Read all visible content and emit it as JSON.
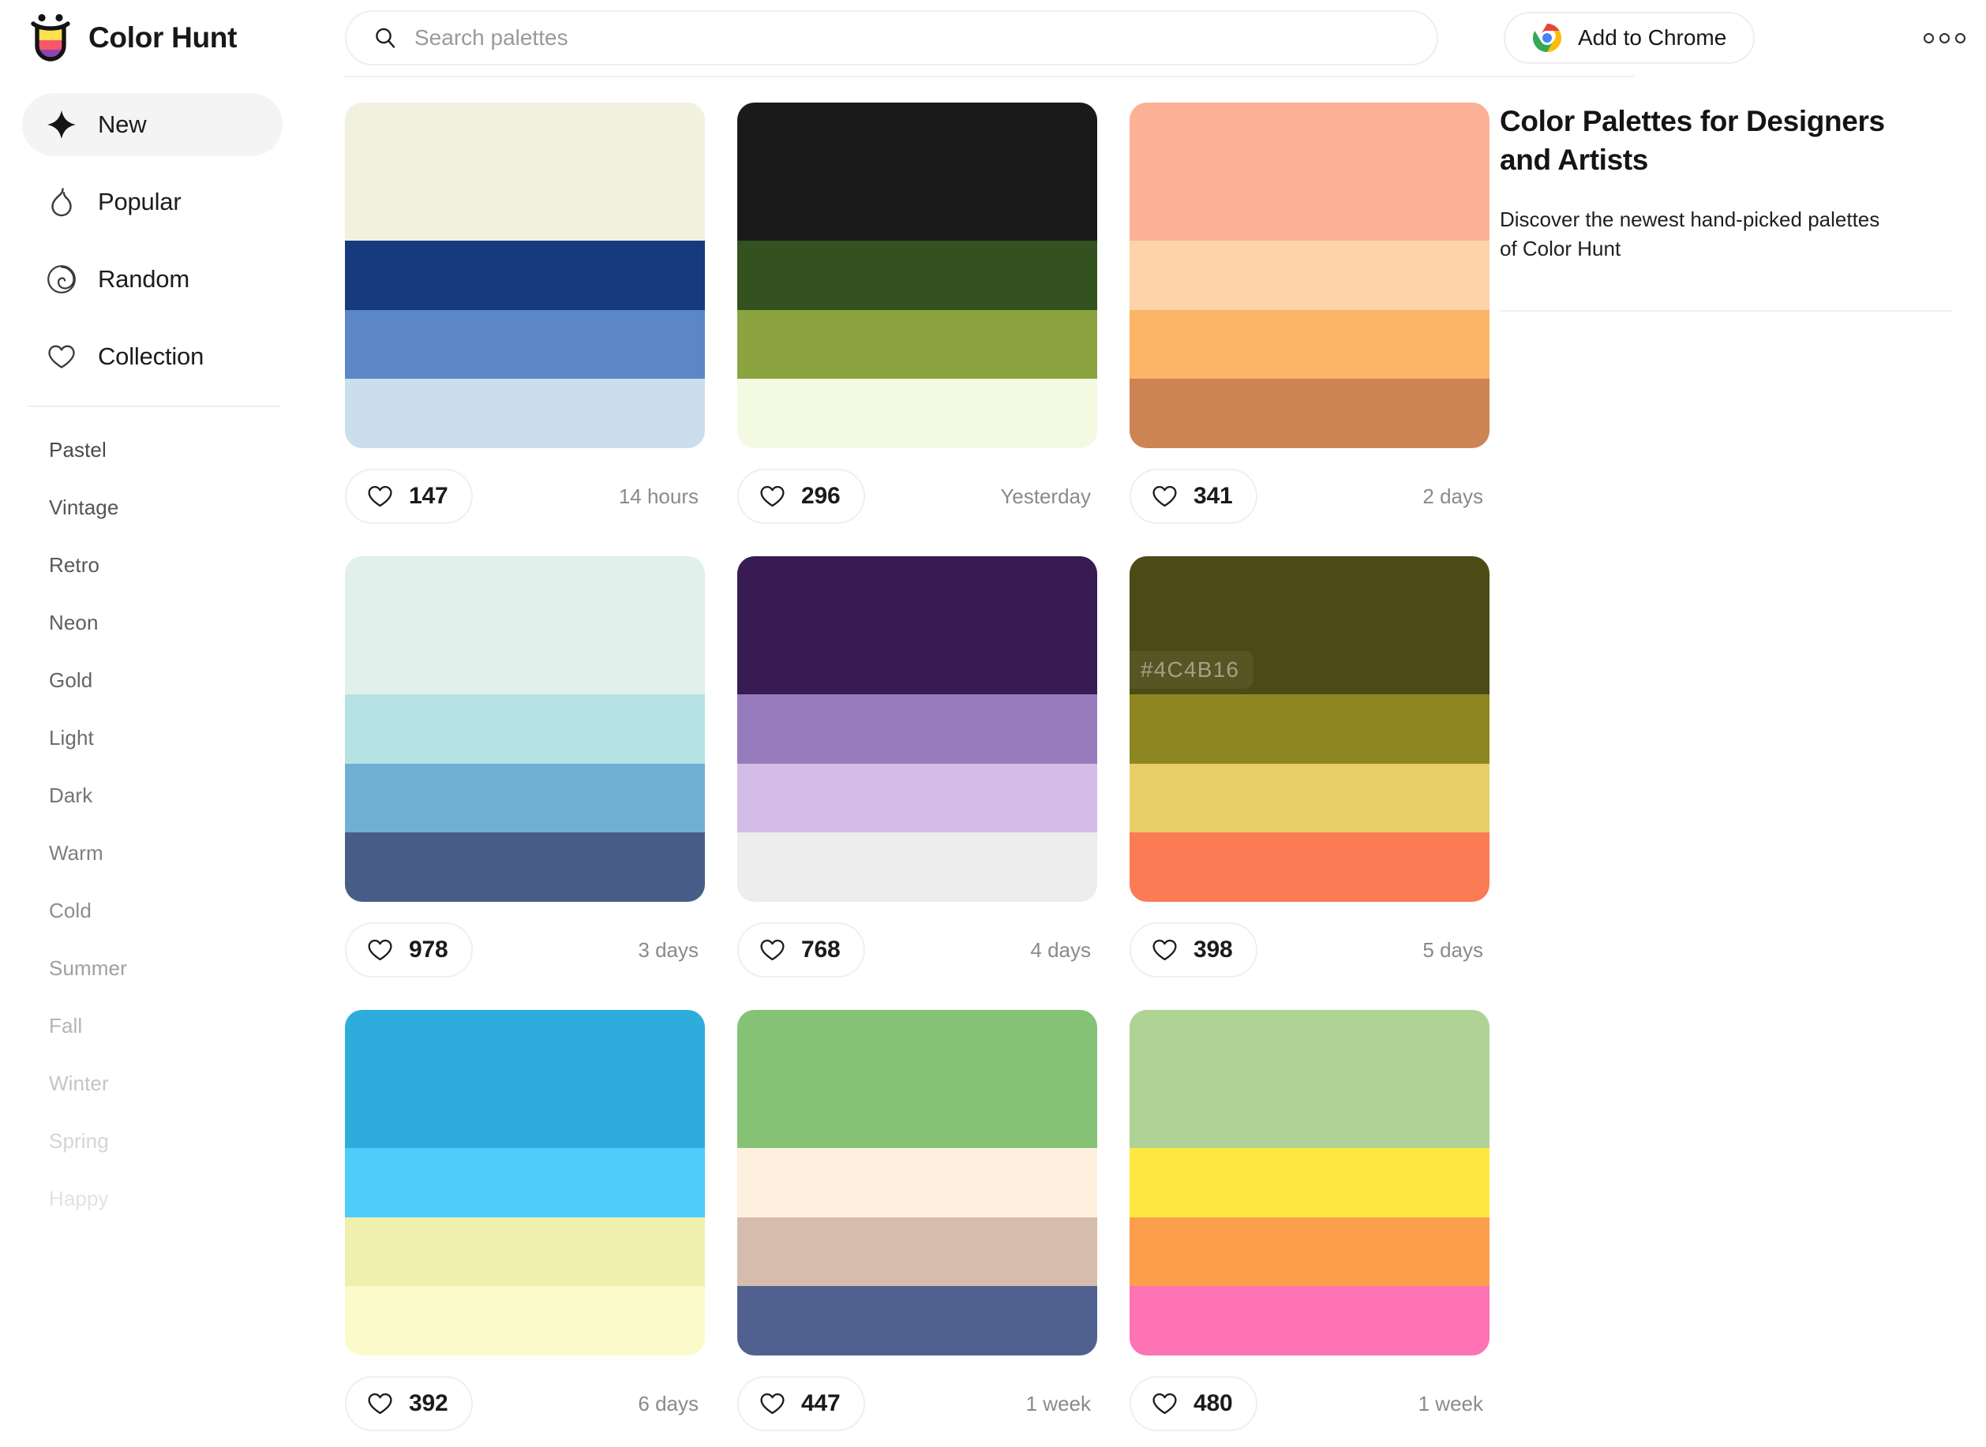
{
  "brand": {
    "name": "Color Hunt",
    "logo_icon": "color-hunt-cup-logo",
    "logo_colors": [
      "#FFE14D",
      "#F8566B",
      "#8E44AD"
    ]
  },
  "search": {
    "placeholder": "Search palettes",
    "value": "",
    "icon": "search-icon"
  },
  "header": {
    "chrome_button_label": "Add to Chrome",
    "chrome_icon": "chrome-icon",
    "more_icon": "three-dots-icon"
  },
  "sidebar": {
    "nav": [
      {
        "label": "New",
        "icon": "sparkle-icon",
        "active": true
      },
      {
        "label": "Popular",
        "icon": "flame-icon",
        "active": false
      },
      {
        "label": "Random",
        "icon": "spiral-icon",
        "active": false
      },
      {
        "label": "Collection",
        "icon": "heart-icon",
        "active": false
      }
    ],
    "tags": [
      {
        "label": "Pastel",
        "color": "#4a4a4a"
      },
      {
        "label": "Vintage",
        "color": "#545454"
      },
      {
        "label": "Retro",
        "color": "#585858"
      },
      {
        "label": "Neon",
        "color": "#5e5e5e"
      },
      {
        "label": "Gold",
        "color": "#646464"
      },
      {
        "label": "Light",
        "color": "#6c6c6c"
      },
      {
        "label": "Dark",
        "color": "#747474"
      },
      {
        "label": "Warm",
        "color": "#7f7f7f"
      },
      {
        "label": "Cold",
        "color": "#8d8d8d"
      },
      {
        "label": "Summer",
        "color": "#a0a0a0"
      },
      {
        "label": "Fall",
        "color": "#b4b4b4"
      },
      {
        "label": "Winter",
        "color": "#c4c4c4"
      },
      {
        "label": "Spring",
        "color": "#d4d4d4"
      },
      {
        "label": "Happy",
        "color": "#e2e2e2"
      }
    ]
  },
  "right_panel": {
    "title": "Color Palettes for Designers and Artists",
    "subtitle": "Discover the newest hand-picked palettes of Color Hunt"
  },
  "palettes": [
    {
      "colors": [
        "#F2F1DE",
        "#163A7D",
        "#5B87C7",
        "#CADEEC"
      ],
      "likes": "147",
      "time": "14 hours",
      "hover_hex": null
    },
    {
      "colors": [
        "#1A1A1A",
        "#33521F",
        "#8BA440",
        "#F3FAE1"
      ],
      "likes": "296",
      "time": "Yesterday",
      "hover_hex": null
    },
    {
      "colors": [
        "#FCB195",
        "#FDD3A9",
        "#FCB467",
        "#CE8354"
      ],
      "likes": "341",
      "time": "2 days",
      "hover_hex": null
    },
    {
      "colors": [
        "#E1F0EA",
        "#B6E2E4",
        "#6EAFD2",
        "#475D87"
      ],
      "likes": "978",
      "time": "3 days",
      "hover_hex": null
    },
    {
      "colors": [
        "#371B52",
        "#967BBD",
        "#D3BCE5",
        "#EDEDED"
      ],
      "likes": "768",
      "time": "4 days",
      "hover_hex": null
    },
    {
      "colors": [
        "#4C4B16",
        "#8E8721",
        "#E7CE66",
        "#FB7B55"
      ],
      "likes": "398",
      "time": "5 days",
      "hover_hex": "#4C4B16"
    },
    {
      "colors": [
        "#2EADDC",
        "#4ECCFA",
        "#F0F0AE",
        "#FBFACB"
      ],
      "likes": "392",
      "time": "6 days",
      "hover_hex": null
    },
    {
      "colors": [
        "#85C275",
        "#FDF0DE",
        "#D6BCAC",
        "#50618F"
      ],
      "likes": "447",
      "time": "1 week",
      "hover_hex": null
    },
    {
      "colors": [
        "#AFD295",
        "#FCE83F",
        "#FD9E4D",
        "#FD73B4"
      ],
      "likes": "480",
      "time": "1 week",
      "hover_hex": null
    }
  ]
}
